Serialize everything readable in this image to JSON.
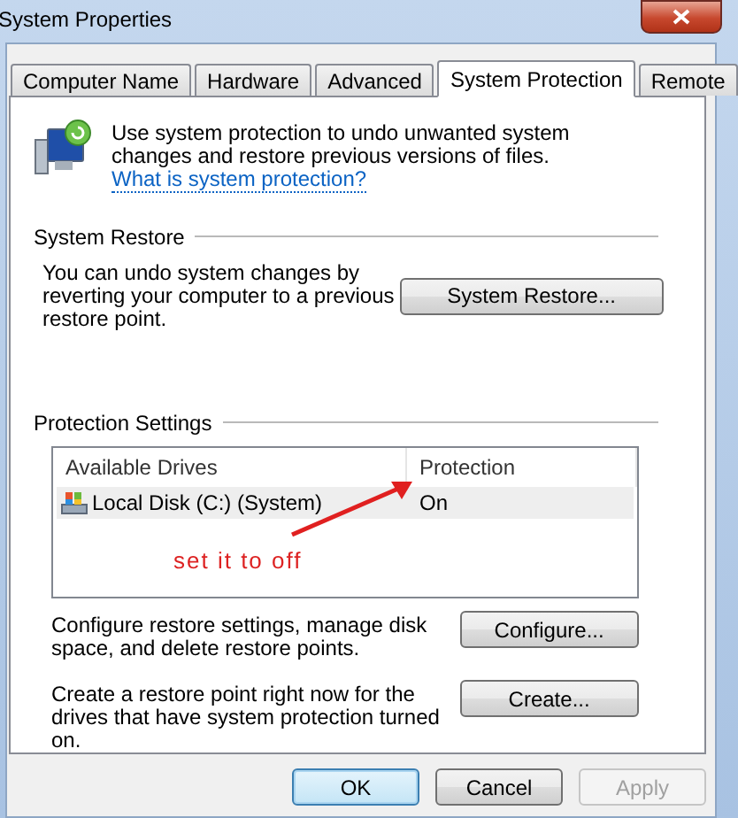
{
  "window": {
    "title": "System Properties"
  },
  "tabs": [
    {
      "label": "Computer Name",
      "selected": false
    },
    {
      "label": "Hardware",
      "selected": false
    },
    {
      "label": "Advanced",
      "selected": false
    },
    {
      "label": "System Protection",
      "selected": true
    },
    {
      "label": "Remote",
      "selected": false
    }
  ],
  "intro": {
    "text": "Use system protection to undo unwanted system changes and restore previous versions of files.",
    "link": "What is system protection?"
  },
  "system_restore": {
    "heading": "System Restore",
    "text": "You can undo system changes by reverting your computer to a previous restore point.",
    "button": "System Restore..."
  },
  "protection_settings": {
    "heading": "Protection Settings",
    "columns": [
      "Available Drives",
      "Protection"
    ],
    "rows": [
      {
        "drive": "Local Disk (C:) (System)",
        "protection": "On",
        "selected": true
      }
    ],
    "actions": [
      {
        "text": "Configure restore settings, manage disk space, and delete restore points.",
        "button": "Configure..."
      },
      {
        "text": "Create a restore point right now for the drives that have system protection turned on.",
        "button": "Create..."
      }
    ]
  },
  "annotation": {
    "text": "set it to off"
  },
  "buttons": [
    {
      "label": "OK",
      "default": true,
      "disabled": false
    },
    {
      "label": "Cancel",
      "default": false,
      "disabled": false
    },
    {
      "label": "Apply",
      "default": false,
      "disabled": true
    }
  ]
}
